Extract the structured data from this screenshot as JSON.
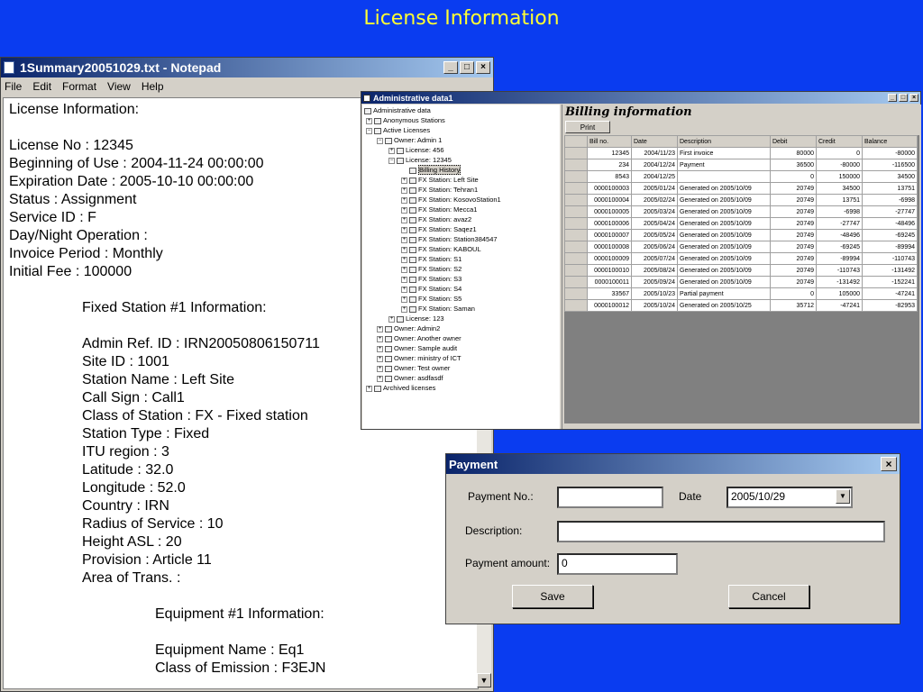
{
  "slide": {
    "title": "License Information"
  },
  "notepad": {
    "title": "1Summary20051029.txt - Notepad",
    "menu": [
      "File",
      "Edit",
      "Format",
      "View",
      "Help"
    ],
    "lines": [
      "License Information:",
      "License No : 12345",
      "Beginning of Use : 2004-11-24 00:00:00",
      "Expiration Date : 2005-10-10 00:00:00",
      "Status : Assignment",
      "Service ID : F",
      "Day/Night Operation :",
      "Invoice Period : Monthly",
      "Initial Fee : 100000",
      "Fixed Station #1 Information:",
      "Admin Ref. ID : IRN20050806150711",
      "Site ID : 1001",
      "Station Name : Left Site",
      "Call Sign : Call1",
      "Class of Station : FX - Fixed station",
      "Station Type : Fixed",
      "ITU region : 3",
      "Latitude : 32.0",
      "Longitude : 52.0",
      "Country : IRN",
      "Radius of Service : 10",
      "Height ASL : 20",
      "Provision : Article 11",
      "Area of Trans. :",
      "Equipment #1 Information:",
      "Equipment Name : Eq1",
      "Class of Emission : F3EJN"
    ]
  },
  "admin": {
    "title": "Administrative data1",
    "tree": [
      "Administrative data",
      "Anonymous Stations",
      "Active Licenses",
      "Owner: Admin 1",
      "License: 456",
      "License: 12345",
      "Billing History",
      "FX Station: Left Site",
      "FX Station: Tehran1",
      "FX Station: KosovoStation1",
      "FX Station: Mecca1",
      "FX Station: avaz2",
      "FX Station: Saqez1",
      "FX Station: Station384547",
      "FX Station: KABOUL",
      "FX Station: S1",
      "FX Station: S2",
      "FX Station: S3",
      "FX Station: S4",
      "FX Station: S5",
      "FX Station: Saman",
      "License: 123",
      "Owner: Admin2",
      "Owner: Another owner",
      "Owner: Sample audit",
      "Owner: ministry of ICT",
      "Owner: Test owner",
      "Owner: asdfasdf",
      "Archived licenses"
    ],
    "billing": {
      "title": "Billing information",
      "print_label": "Print",
      "columns": [
        "Bill no.",
        "Date",
        "Description",
        "Debit",
        "Credit",
        "Balance"
      ],
      "rows": [
        [
          "12345",
          "2004/11/23",
          "First invoice",
          "80000",
          "0",
          "-80000"
        ],
        [
          "234",
          "2004/12/24",
          "Payment",
          "36500",
          "-80000",
          "-116500"
        ],
        [
          "8543",
          "2004/12/25",
          "",
          "0",
          "150000",
          "34500"
        ],
        [
          "0000100003",
          "2005/01/24",
          "Generated on 2005/10/09",
          "20749",
          "34500",
          "13751"
        ],
        [
          "0000100004",
          "2005/02/24",
          "Generated on 2005/10/09",
          "20749",
          "13751",
          "-6998"
        ],
        [
          "0000100005",
          "2005/03/24",
          "Generated on 2005/10/09",
          "20749",
          "-6998",
          "-27747"
        ],
        [
          "0000100006",
          "2005/04/24",
          "Generated on 2005/10/09",
          "20749",
          "-27747",
          "-48496"
        ],
        [
          "0000100007",
          "2005/05/24",
          "Generated on 2005/10/09",
          "20749",
          "-48496",
          "-69245"
        ],
        [
          "0000100008",
          "2005/06/24",
          "Generated on 2005/10/09",
          "20749",
          "-69245",
          "-89994"
        ],
        [
          "0000100009",
          "2005/07/24",
          "Generated on 2005/10/09",
          "20749",
          "-89994",
          "-110743"
        ],
        [
          "0000100010",
          "2005/08/24",
          "Generated on 2005/10/09",
          "20749",
          "-110743",
          "-131492"
        ],
        [
          "0000100011",
          "2005/09/24",
          "Generated on 2005/10/09",
          "20749",
          "-131492",
          "-152241"
        ],
        [
          "33567",
          "2005/10/23",
          "Partial payment",
          "0",
          "105000",
          "-47241"
        ],
        [
          "0000100012",
          "2005/10/24",
          "Generated on 2005/10/25",
          "35712",
          "-47241",
          "-82953"
        ]
      ]
    }
  },
  "payment": {
    "title": "Payment",
    "payment_no_label": "Payment No.:",
    "payment_no_value": "",
    "date_label": "Date",
    "date_value": "2005/10/29",
    "description_label": "Description:",
    "description_value": "",
    "amount_label": "Payment amount:",
    "amount_value": "0",
    "save_label": "Save",
    "cancel_label": "Cancel"
  }
}
